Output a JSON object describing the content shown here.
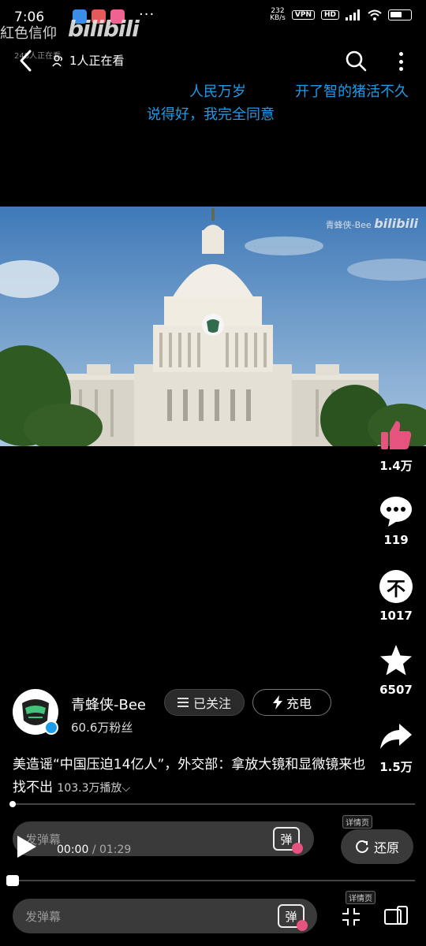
{
  "status": {
    "time": "7:06",
    "netspeed_value": "232",
    "netspeed_unit": "KB/s",
    "vpn": "VPN",
    "hd": "HD",
    "more": "···"
  },
  "watermark": {
    "text": "紅色信仰",
    "logo": "bilibili",
    "sub": "248人正在看"
  },
  "nav": {
    "viewers": "1人正在看"
  },
  "danmaku": [
    {
      "text": "人民万岁"
    },
    {
      "text": "开了智的猪活不久"
    },
    {
      "text": "说得好，我完全同意"
    }
  ],
  "video": {
    "watermark_name": "青蜂侠-Bee",
    "watermark_logo": "bilibili"
  },
  "rail": {
    "like_count": "1.4万",
    "comment_count": "119",
    "coin_count": "1017",
    "fav_count": "6507",
    "share_count": "1.5万",
    "coin_glyph": "不"
  },
  "author": {
    "name": "青蜂侠-Bee",
    "fans": "60.6万粉丝",
    "follow_label": "已关注",
    "charge_label": "充电"
  },
  "post": {
    "title": "美造谣“中国压迫14亿人”，外交部：拿放大镜和显微镜来也找不出",
    "plays": "103.3万播放"
  },
  "player": {
    "danmu_placeholder": "发弹幕",
    "danmu_toggle": "弹",
    "time_current": "00:00",
    "time_sep": "/",
    "time_total": "01:29",
    "restore_label": "还原",
    "detail_tag": "详情页"
  },
  "colors": {
    "danmaku": "#1e9be8",
    "like": "#e7537f",
    "verify": "#1e9be8"
  }
}
